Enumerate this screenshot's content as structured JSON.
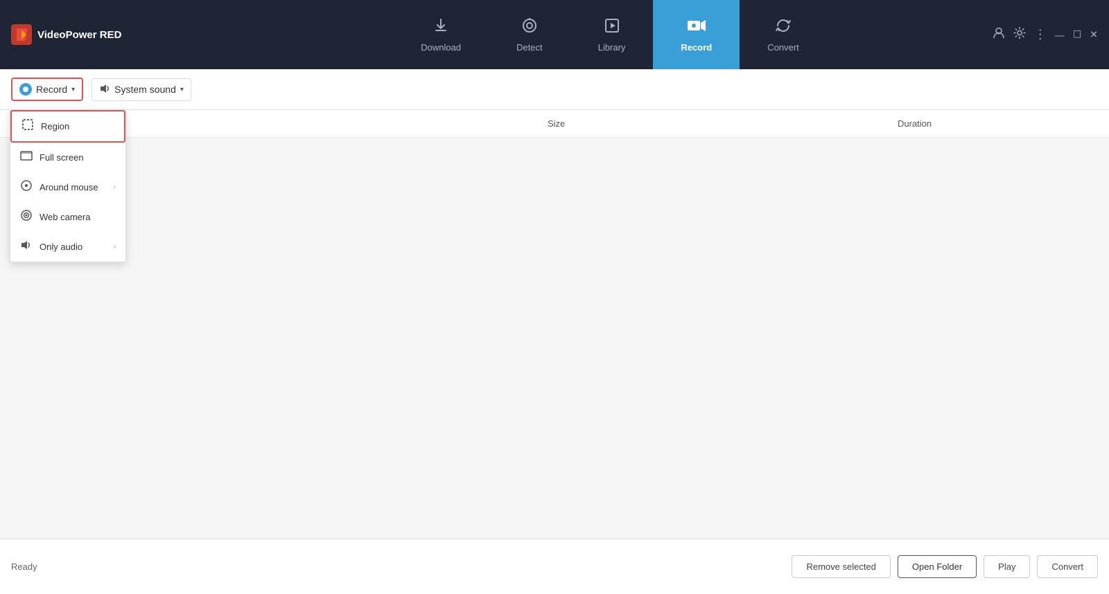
{
  "app": {
    "title": "VideoPower RED"
  },
  "nav": {
    "tabs": [
      {
        "id": "download",
        "label": "Download",
        "icon": "⬇"
      },
      {
        "id": "detect",
        "label": "Detect",
        "icon": "⚙"
      },
      {
        "id": "library",
        "label": "Library",
        "icon": "▶"
      },
      {
        "id": "record",
        "label": "Record",
        "icon": "🎥",
        "active": true
      },
      {
        "id": "convert",
        "label": "Convert",
        "icon": "🔄"
      }
    ]
  },
  "toolbar": {
    "record_label": "Record",
    "sound_label": "System sound"
  },
  "dropdown": {
    "items": [
      {
        "id": "region",
        "label": "Region",
        "icon": "⬚",
        "selected": true
      },
      {
        "id": "fullscreen",
        "label": "Full screen",
        "icon": "🖥"
      },
      {
        "id": "around_mouse",
        "label": "Around mouse",
        "icon": "⊙",
        "has_arrow": true
      },
      {
        "id": "web_camera",
        "label": "Web camera",
        "icon": "◉"
      },
      {
        "id": "only_audio",
        "label": "Only audio",
        "icon": "🔊",
        "has_arrow": true
      }
    ]
  },
  "table": {
    "col_size": "Size",
    "col_duration": "Duration"
  },
  "bottom": {
    "status": "Ready",
    "remove_selected": "Remove selected",
    "open_folder": "Open Folder",
    "play": "Play",
    "convert": "Convert"
  },
  "titlebar_controls": {
    "account": "👤",
    "settings": "✦",
    "menu": "⋮",
    "minimize": "—",
    "maximize": "☐",
    "close": "✕"
  }
}
